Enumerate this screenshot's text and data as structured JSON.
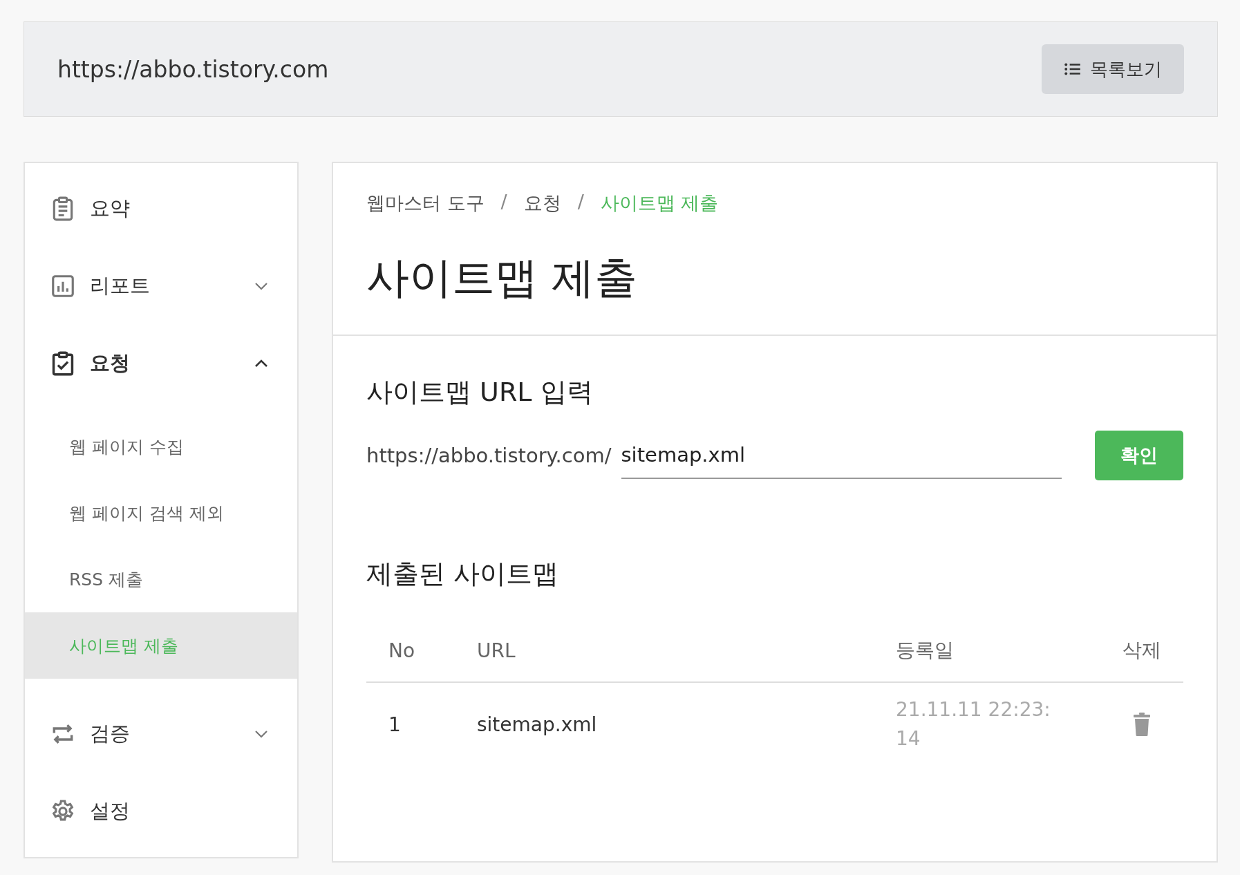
{
  "header": {
    "url": "https://abbo.tistory.com",
    "list_button": "목록보기"
  },
  "sidebar": {
    "items": [
      {
        "label": "요약",
        "kind": "link",
        "selected": false
      },
      {
        "label": "리포트",
        "kind": "group",
        "selected": false,
        "expanded": false
      },
      {
        "label": "요청",
        "kind": "group",
        "selected": true,
        "expanded": true,
        "children": [
          {
            "label": "웹 페이지 수집",
            "selected": false
          },
          {
            "label": "웹 페이지 검색 제외",
            "selected": false
          },
          {
            "label": "RSS 제출",
            "selected": false
          },
          {
            "label": "사이트맵 제출",
            "selected": true
          }
        ]
      },
      {
        "label": "검증",
        "kind": "group",
        "selected": false,
        "expanded": false
      },
      {
        "label": "설정",
        "kind": "link",
        "selected": false
      }
    ]
  },
  "breadcrumb": [
    {
      "label": "웹마스터 도구",
      "current": false
    },
    {
      "label": "요청",
      "current": false
    },
    {
      "label": "사이트맵 제출",
      "current": true
    }
  ],
  "breadcrumb_separators": [
    "/",
    "/"
  ],
  "title": "사이트맵 제출",
  "url_section": {
    "heading": "사이트맵 URL 입력",
    "prefix": "https://abbo.tistory.com/",
    "value": "sitemap.xml",
    "button": "확인"
  },
  "submitted": {
    "heading": "제출된 사이트맵",
    "columns": [
      "No",
      "URL",
      "등록일",
      "삭제"
    ],
    "rows": [
      {
        "no": "1",
        "url": "sitemap.xml",
        "date": "21.11.11 22:23:14"
      }
    ]
  }
}
